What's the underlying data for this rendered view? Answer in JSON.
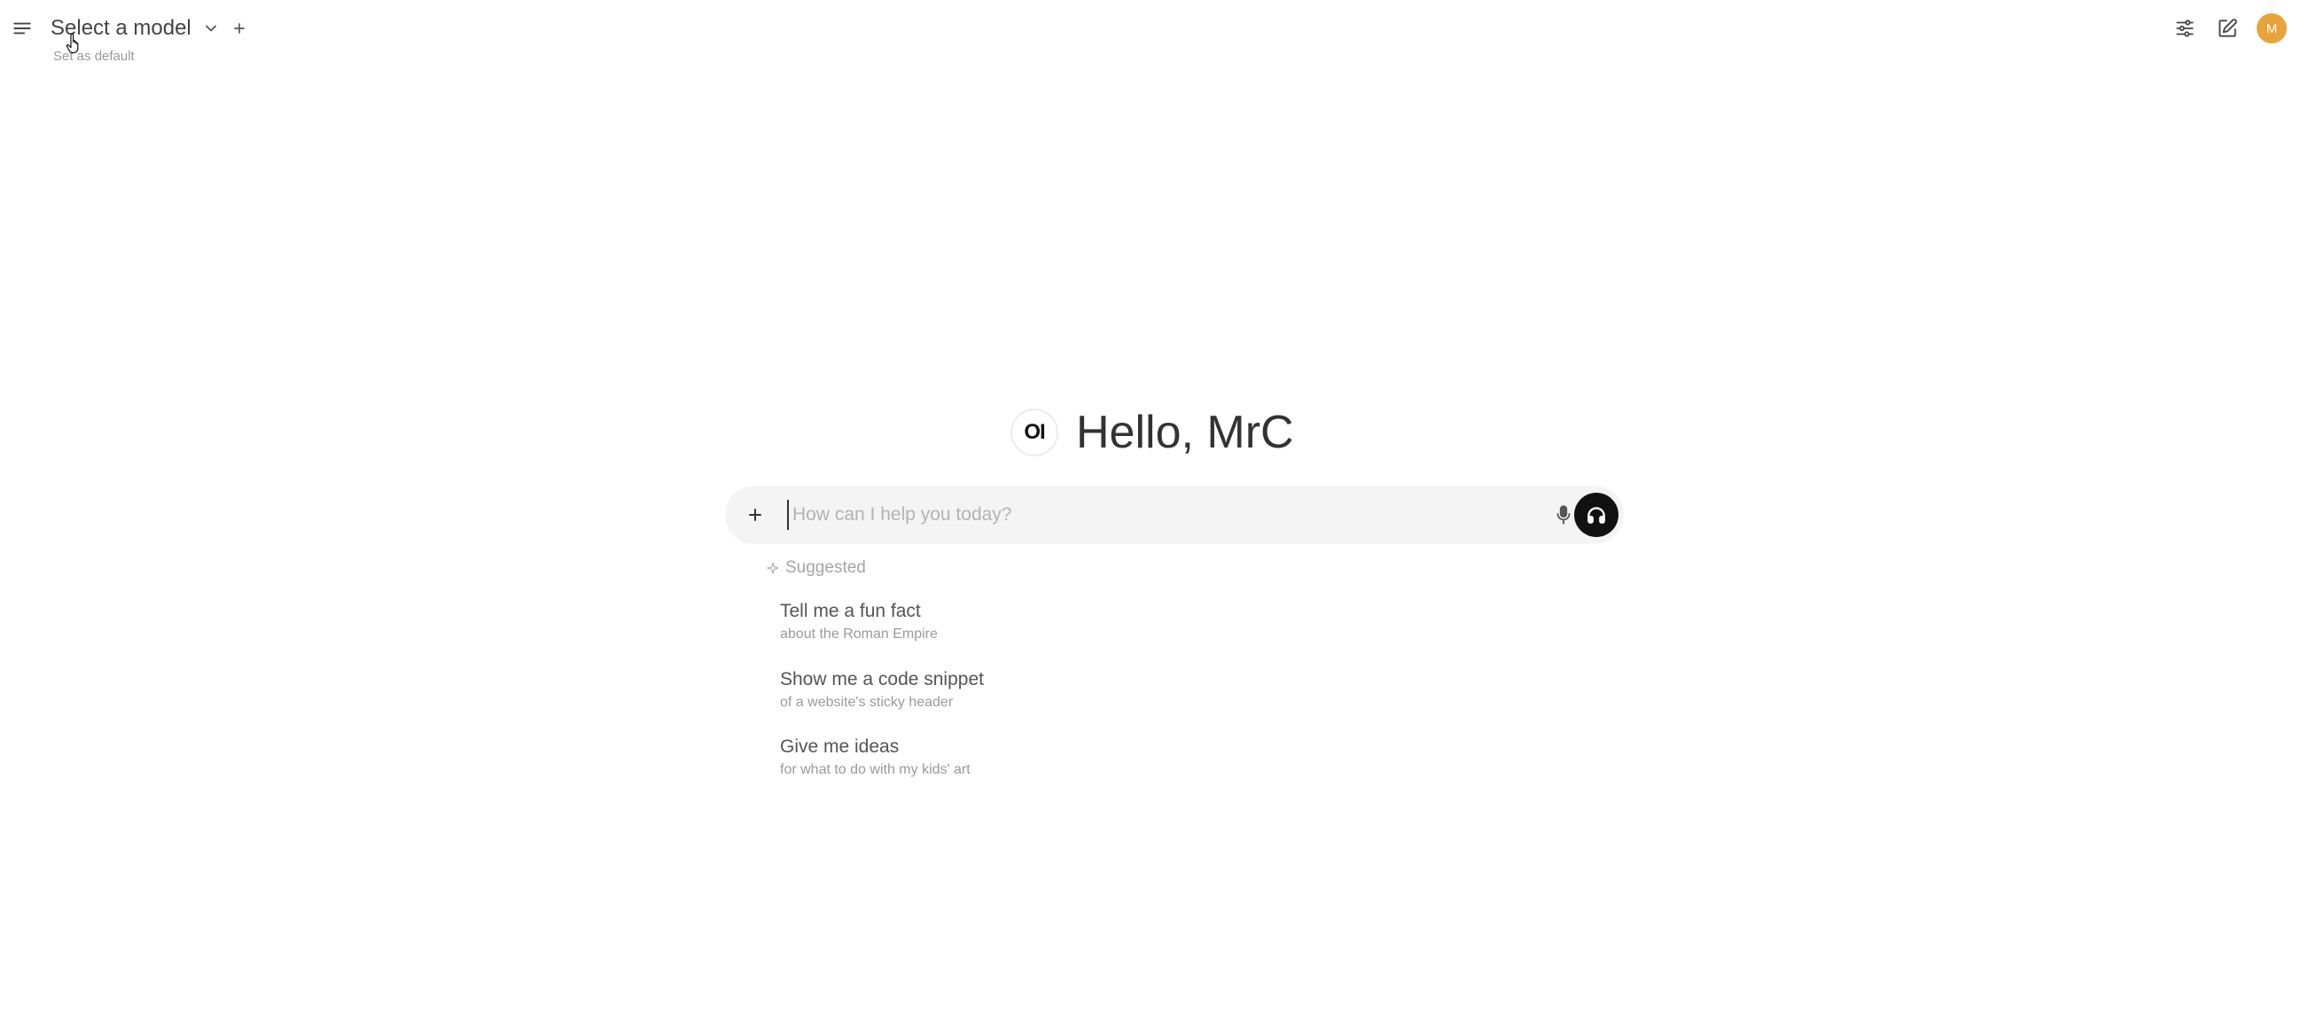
{
  "header": {
    "model_selector_label": "Select a model",
    "set_default_label": "Set as default",
    "avatar_initial": "M",
    "avatar_color": "#e8a33a"
  },
  "main": {
    "logo_text": "OI",
    "greeting": "Hello, MrC",
    "input": {
      "placeholder": "How can I help you today?",
      "value": ""
    },
    "suggested_label": "Suggested",
    "suggestions": [
      {
        "title": "Tell me a fun fact",
        "subtitle": "about the Roman Empire"
      },
      {
        "title": "Show me a code snippet",
        "subtitle": "of a website's sticky header"
      },
      {
        "title": "Give me ideas",
        "subtitle": "for what to do with my kids' art"
      }
    ]
  },
  "icons": {
    "menu": "menu-icon",
    "chevron": "chevron-down-icon",
    "add": "plus-icon",
    "controls": "sliders-icon",
    "new_chat": "pencil-square-icon",
    "mic": "microphone-icon",
    "voice": "headphones-icon",
    "sparkle": "sparkle-icon"
  }
}
